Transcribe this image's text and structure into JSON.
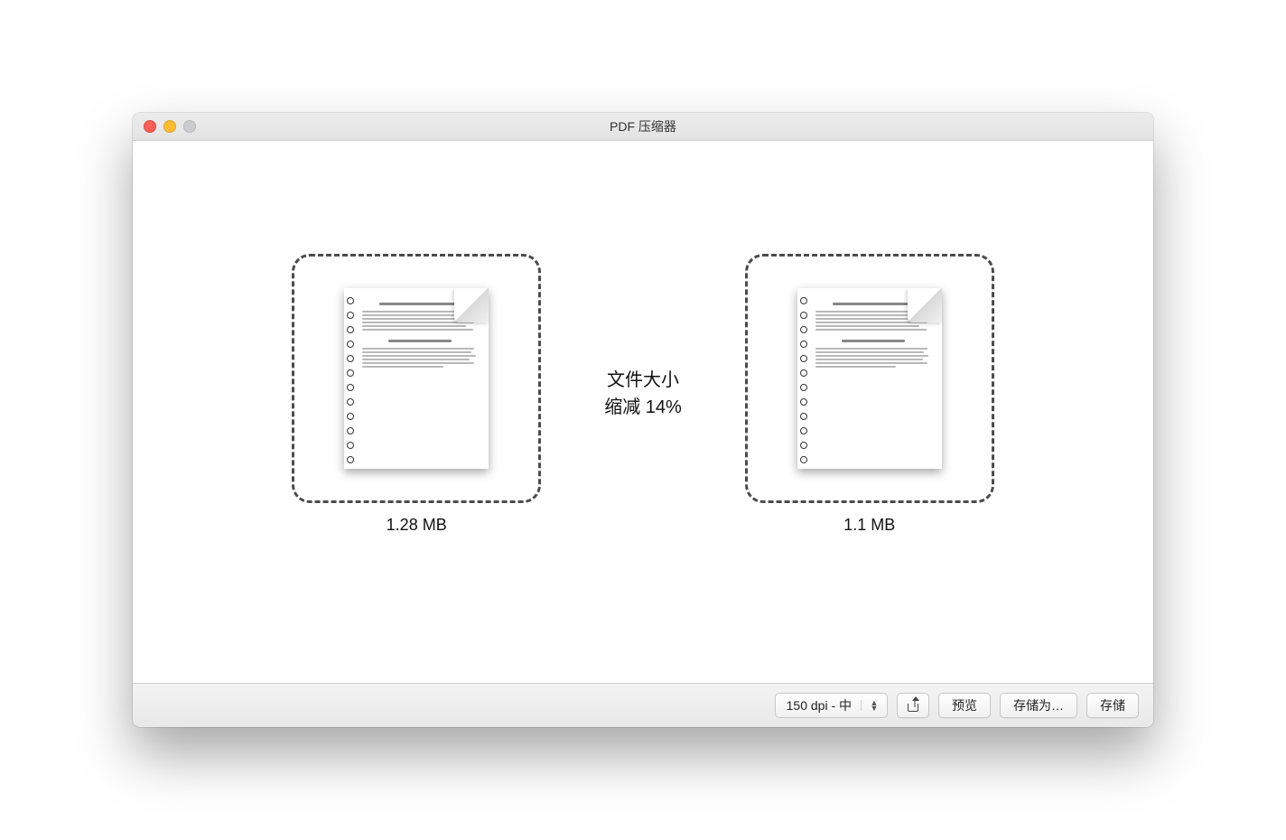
{
  "window": {
    "title": "PDF 压缩器"
  },
  "original": {
    "size": "1.28 MB"
  },
  "compressed": {
    "size": "1.1 MB"
  },
  "info": {
    "line1": "文件大小",
    "line2": "缩减 14%"
  },
  "toolbar": {
    "dpi_select": "150 dpi - 中",
    "preview": "预览",
    "save_as": "存储为…",
    "save": "存储"
  }
}
